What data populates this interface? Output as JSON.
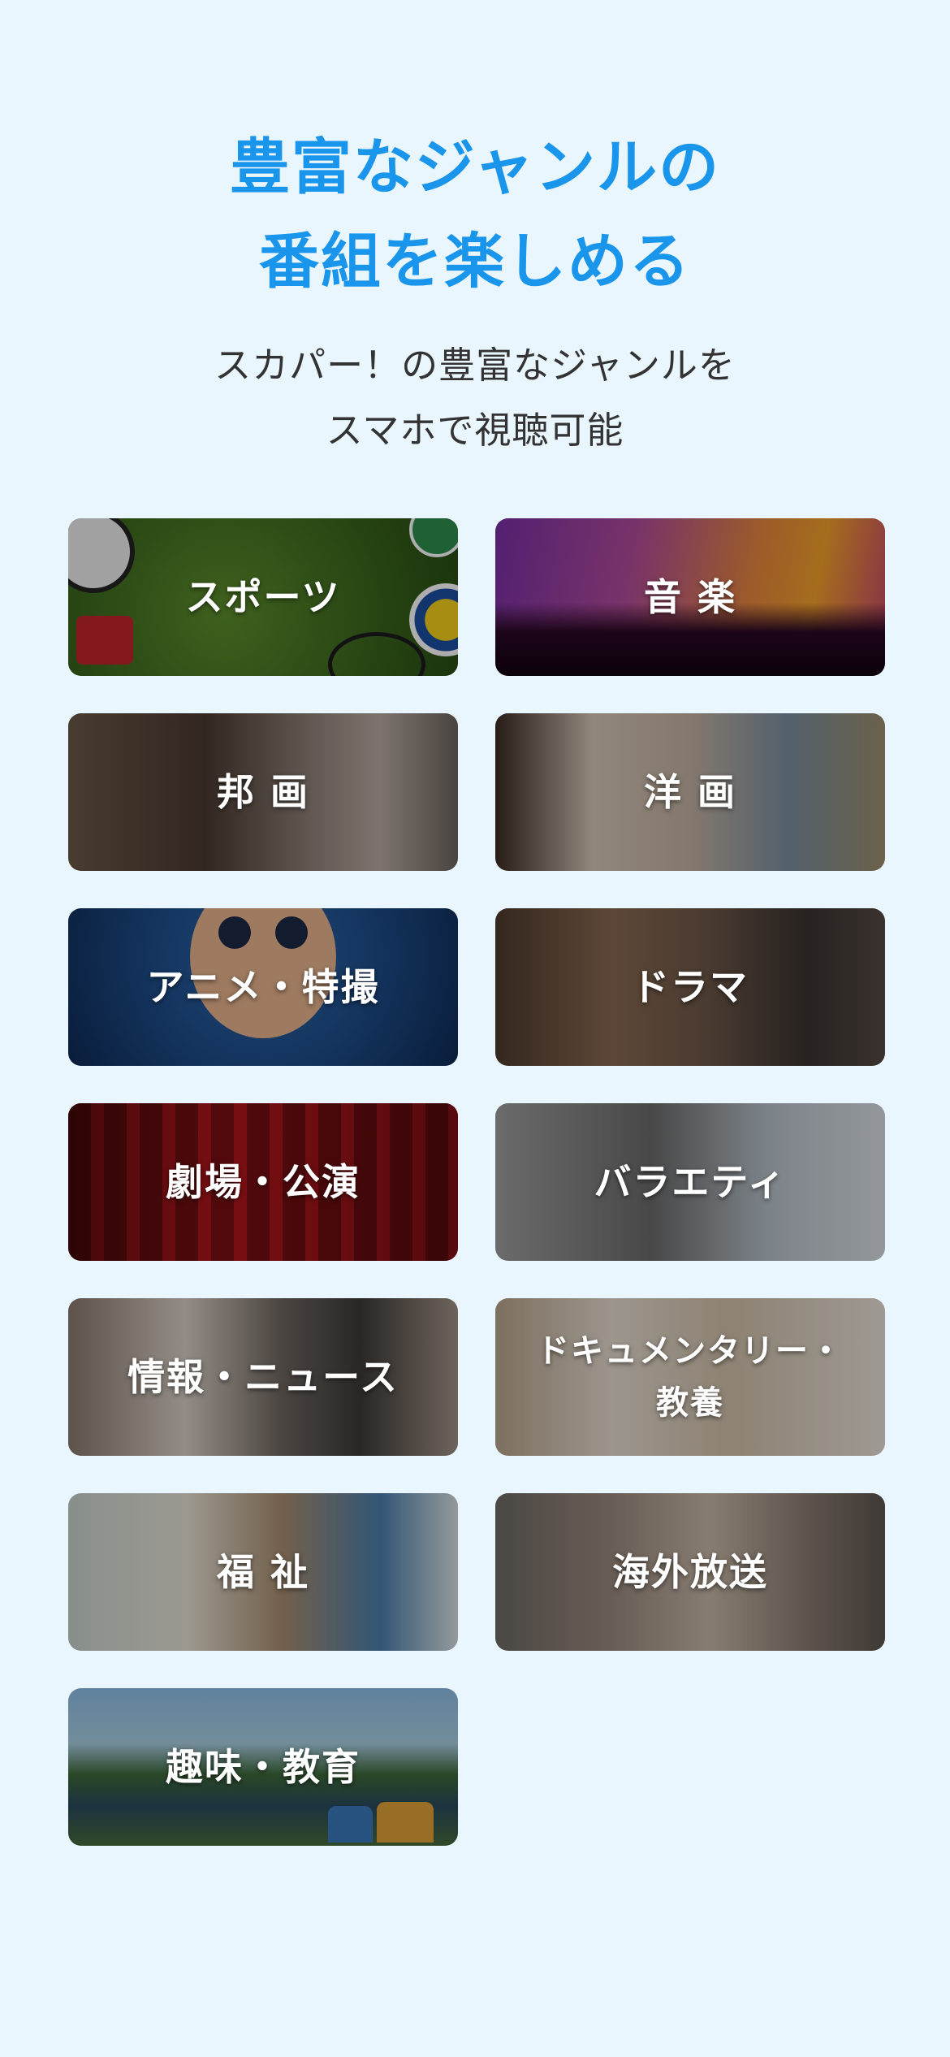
{
  "headline": {
    "line1": "豊富なジャンルの",
    "line2": "番組を楽しめる"
  },
  "subhead": {
    "line1": "スカパー！の豊富なジャンルを",
    "line2": "スマホで視聴可能"
  },
  "genres": [
    {
      "label": "スポーツ"
    },
    {
      "label": "音 楽"
    },
    {
      "label": "邦 画"
    },
    {
      "label": "洋 画"
    },
    {
      "label": "アニメ・特撮"
    },
    {
      "label": "ドラマ"
    },
    {
      "label": "劇場・公演"
    },
    {
      "label": "バラエティ"
    },
    {
      "label": "情報・ニュース"
    },
    {
      "label_line1": "ドキュメンタリー・",
      "label_line2": "教養"
    },
    {
      "label": "福 祉"
    },
    {
      "label": "海外放送"
    },
    {
      "label": "趣味・教育"
    }
  ],
  "colors": {
    "background": "#eaf6fe",
    "headline": "#1a95ec",
    "subhead": "#333333"
  }
}
